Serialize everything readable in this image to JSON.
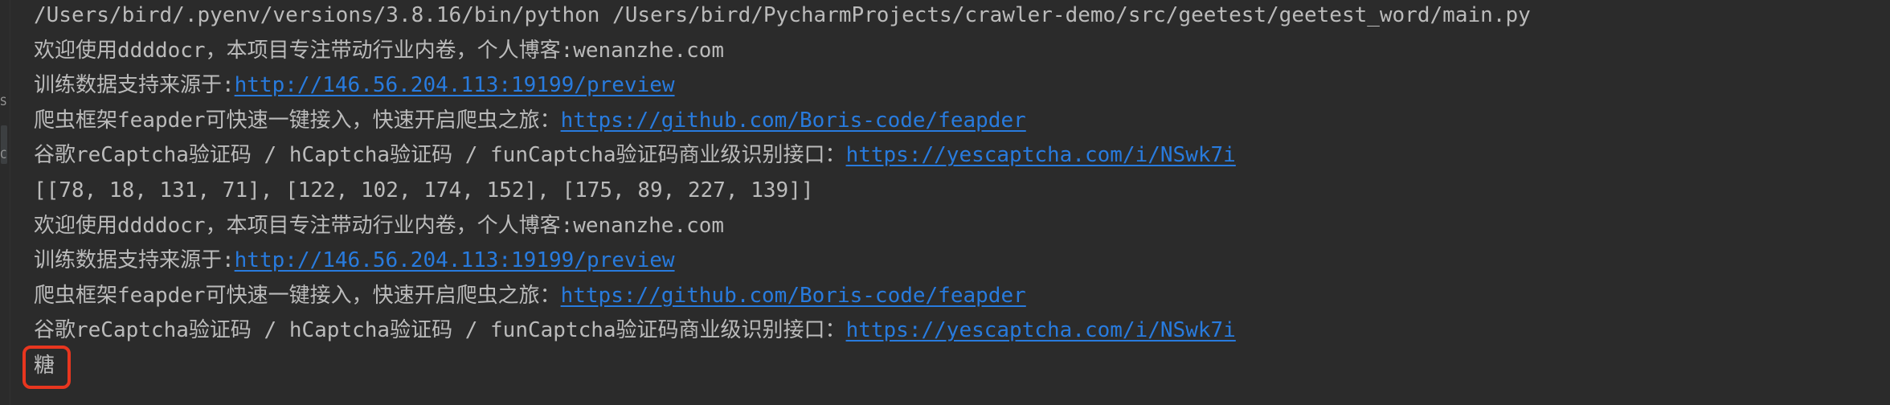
{
  "console": {
    "command": "/Users/bird/.pyenv/versions/3.8.16/bin/python /Users/bird/PycharmProjects/crawler-demo/src/geetest/geetest_word/main.py",
    "blocks": [
      {
        "welcome": "欢迎使用ddddocr，本项目专注带动行业内卷，个人博客:wenanzhe.com",
        "train_prefix": "训练数据支持来源于:",
        "train_link": "http://146.56.204.113:19199/preview",
        "feapder_prefix": "爬虫框架feapder可快速一键接入，快速开启爬虫之旅：",
        "feapder_link": "https://github.com/Boris-code/feapder",
        "captcha_prefix": "谷歌reCaptcha验证码 / hCaptcha验证码 / funCaptcha验证码商业级识别接口：",
        "captcha_link": "https://yescaptcha.com/i/NSwk7i"
      },
      {
        "welcome": "欢迎使用ddddocr，本项目专注带动行业内卷，个人博客:wenanzhe.com",
        "train_prefix": "训练数据支持来源于:",
        "train_link": "http://146.56.204.113:19199/preview",
        "feapder_prefix": "爬虫框架feapder可快速一键接入，快速开启爬虫之旅：",
        "feapder_link": "https://github.com/Boris-code/feapder",
        "captcha_prefix": "谷歌reCaptcha验证码 / hCaptcha验证码 / funCaptcha验证码商业级识别接口：",
        "captcha_link": "https://yescaptcha.com/i/NSwk7i"
      }
    ],
    "boxes_output": "[[78, 18, 131, 71], [122, 102, 174, 152], [175, 89, 227, 139]]",
    "result_char": "糖",
    "gutter_glyphs": [
      "S",
      "C"
    ],
    "colors": {
      "background": "#2b2b2b",
      "text": "#bbbbbb",
      "link": "#287bde",
      "highlight": "#e8361f"
    }
  }
}
